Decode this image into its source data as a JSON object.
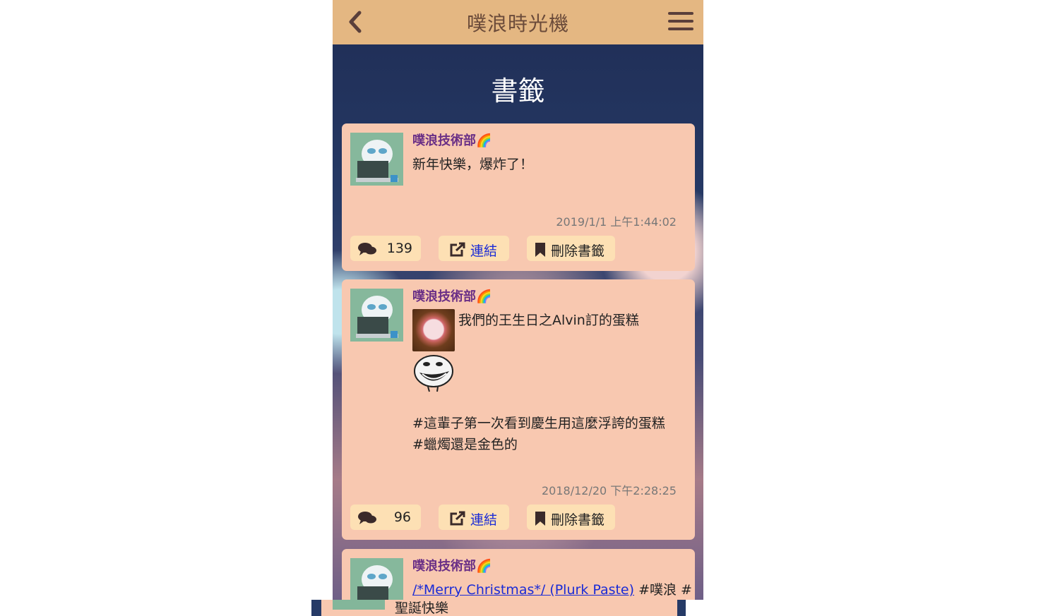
{
  "header": {
    "title": "噗浪時光機",
    "back_icon": "chevron-left-icon",
    "menu_icon": "hamburger-menu-icon"
  },
  "page": {
    "title": "書籤"
  },
  "posts": [
    {
      "user": "噗浪技術部",
      "user_badge": "🌈",
      "text_lines": [
        "新年快樂，爆炸了！"
      ],
      "timestamp": "2019/1/1 上午1:44:02",
      "comments": "139",
      "link_label": "連結",
      "remove_label": "刪除書籤"
    },
    {
      "user": "噗浪技術部",
      "user_badge": "🌈",
      "caption": "我們的王生日之Alvin訂的蛋糕",
      "text_lines": [
        "#這輩子第一次看到慶生用這麼浮誇的蛋糕",
        "#蠟燭還是金色的"
      ],
      "timestamp": "2018/12/20 下午2:28:25",
      "comments": "96",
      "link_label": "連結",
      "remove_label": "刪除書籤"
    },
    {
      "user": "噗浪技術部",
      "user_badge": "🌈",
      "link_text": "/*Merry Christmas*/ (Plurk Paste)",
      "text_after": " #噗浪 #",
      "text_next": "聖誕快樂"
    }
  ],
  "colors": {
    "header_bg": "#e4b782",
    "card_bg": "#f8c8b0",
    "button_bg": "#fde0b4",
    "username": "#6a2f86",
    "link": "#1a2bd6"
  }
}
